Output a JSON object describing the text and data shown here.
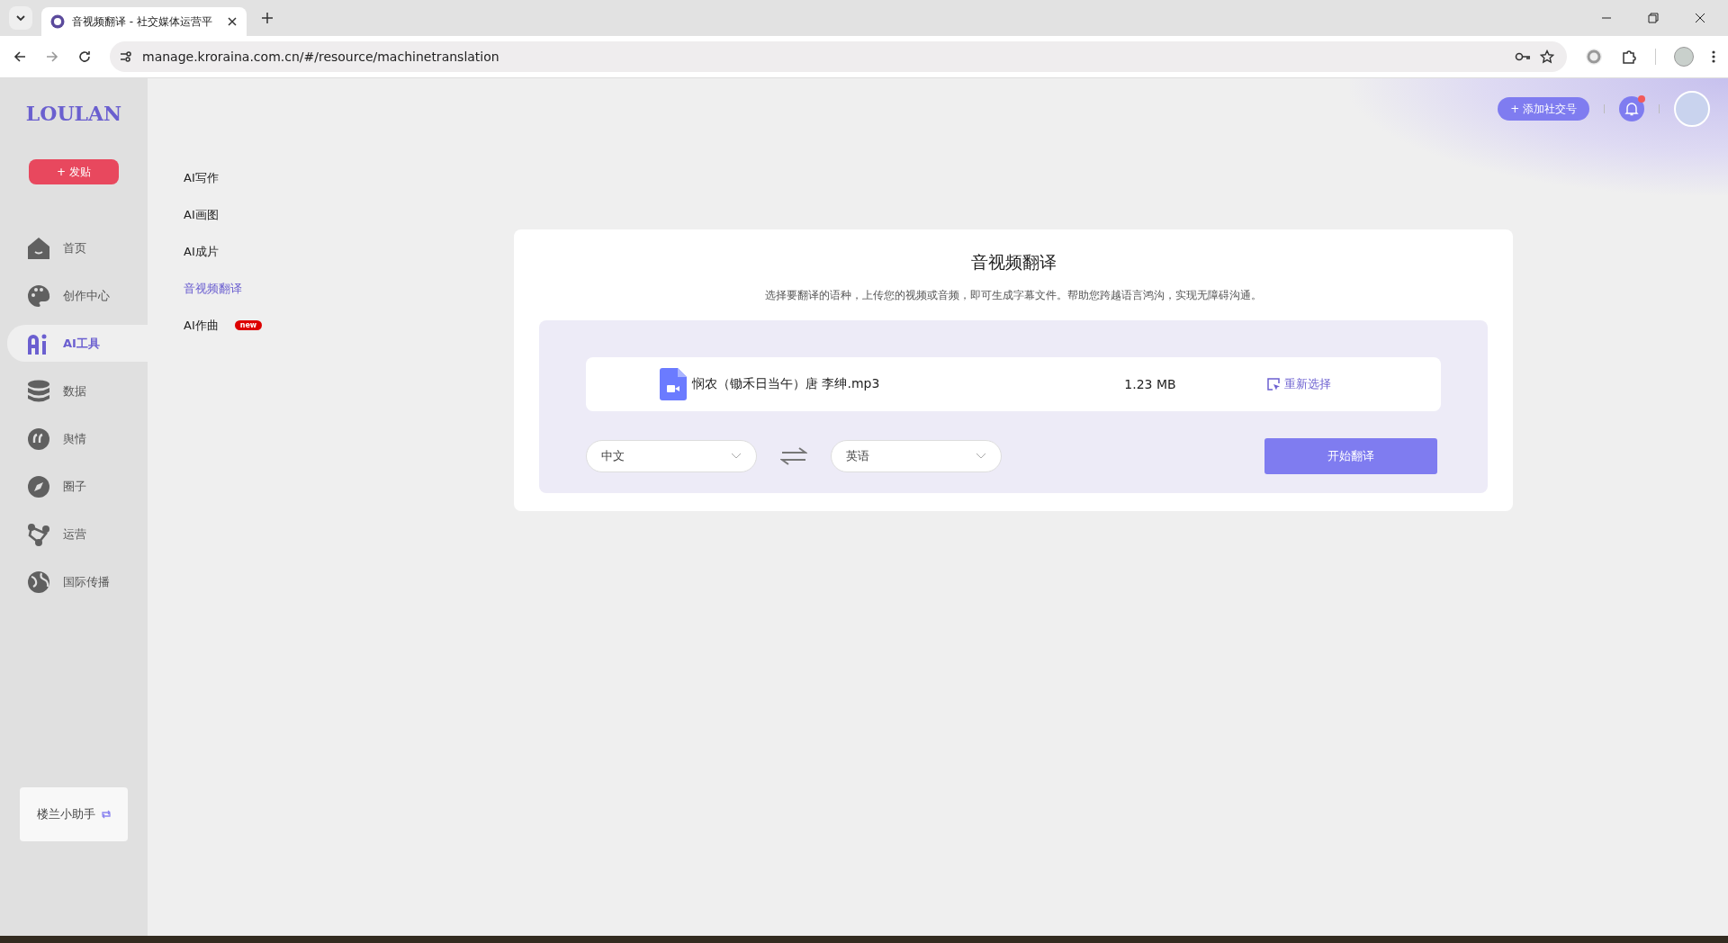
{
  "browser": {
    "tab_title": "音视频翻译 - 社交媒体运营平",
    "url": "manage.kroraina.com.cn/#/resource/machinetranslation"
  },
  "sidebar": {
    "logo": "LOULAN",
    "post_button": "+ 发贴",
    "items": [
      {
        "label": "首页",
        "selected": false
      },
      {
        "label": "创作中心",
        "selected": false
      },
      {
        "label": "AI工具",
        "selected": true
      },
      {
        "label": "数据",
        "selected": false
      },
      {
        "label": "舆情",
        "selected": false
      },
      {
        "label": "圈子",
        "selected": false
      },
      {
        "label": "运营",
        "selected": false
      },
      {
        "label": "国际传播",
        "selected": false
      }
    ],
    "assistant": "楼兰小助手"
  },
  "submenu": [
    {
      "label": "AI写作",
      "selected": false
    },
    {
      "label": "AI画图",
      "selected": false
    },
    {
      "label": "AI成片",
      "selected": false
    },
    {
      "label": "音视频翻译",
      "selected": true
    },
    {
      "label": "AI作曲",
      "selected": false,
      "badge": "new"
    }
  ],
  "header": {
    "add_account_button": "+ 添加社交号",
    "notification_dot": true
  },
  "card": {
    "title": "音视频翻译",
    "description": "选择要翻译的语种，上传您的视频或音频，即可生成字幕文件。帮助您跨越语言鸿沟，实现无障碍沟通。",
    "file": {
      "name": "悯农（锄禾日当午）唐 李绅.mp3",
      "size": "1.23 MB",
      "reselect": "重新选择"
    },
    "source_language": "中文",
    "target_language": "英语",
    "start_button": "开始翻译"
  }
}
